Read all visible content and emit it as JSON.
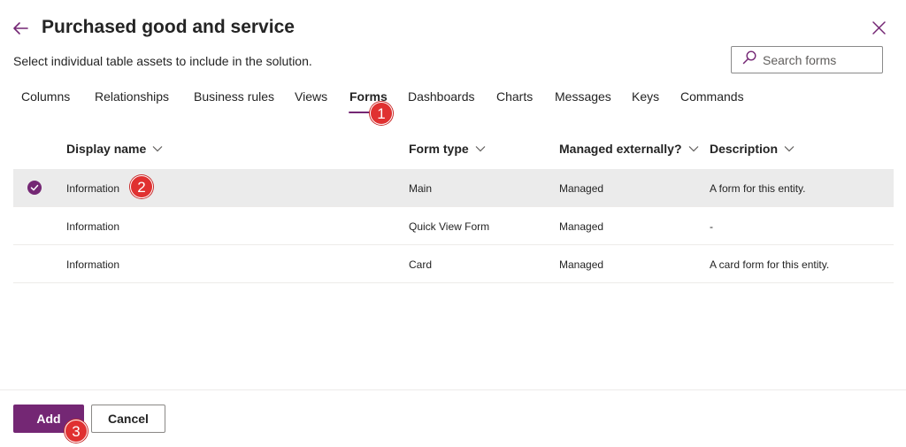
{
  "header": {
    "title": "Purchased good and service",
    "subtitle": "Select individual table assets to include in the solution."
  },
  "search": {
    "placeholder": "Search forms"
  },
  "tabs": [
    {
      "label": "Columns"
    },
    {
      "label": "Relationships"
    },
    {
      "label": "Business rules"
    },
    {
      "label": "Views"
    },
    {
      "label": "Forms",
      "active": true
    },
    {
      "label": "Dashboards"
    },
    {
      "label": "Charts"
    },
    {
      "label": "Messages"
    },
    {
      "label": "Keys"
    },
    {
      "label": "Commands"
    }
  ],
  "grid": {
    "columns": [
      "Display name",
      "Form type",
      "Managed externally?",
      "Description"
    ],
    "rows": [
      {
        "display_name": "Information",
        "form_type": "Main",
        "managed": "Managed",
        "description": "A form for this entity.",
        "selected": true
      },
      {
        "display_name": "Information",
        "form_type": "Quick View Form",
        "managed": "Managed",
        "description": "-",
        "selected": false
      },
      {
        "display_name": "Information",
        "form_type": "Card",
        "managed": "Managed",
        "description": "A card form for this entity.",
        "selected": false
      }
    ]
  },
  "footer": {
    "add_label": "Add",
    "cancel_label": "Cancel"
  },
  "annotations": [
    "1",
    "2",
    "3"
  ],
  "colors": {
    "accent": "#742774",
    "badge": "#e03131",
    "selected_row": "#ebebeb"
  }
}
